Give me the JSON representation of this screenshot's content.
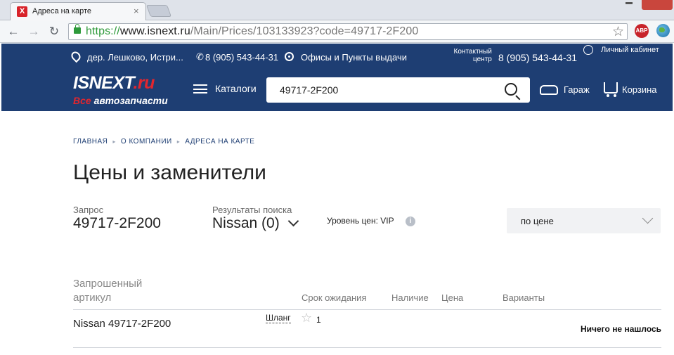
{
  "browser": {
    "tab_title": "Адреса на карте",
    "tab_close": "×",
    "url_proto": "https://",
    "url_host": "www.isnext.ru",
    "url_path": "/Main/Prices/103133923?code=49717-2F200",
    "ext_abp": "ABP"
  },
  "header": {
    "location": "дер. Лешково, Истри...",
    "phone": "8 (905) 543-44-31",
    "offices": "Офисы и Пункты выдачи",
    "contact_center_label_1": "Контактный",
    "contact_center_label_2": "центр",
    "contact_center_phone": "8 (905) 543-44-31",
    "account": "Личный кабинет",
    "logo_main": "ISNEXT",
    "logo_ru": ".ru",
    "logo_tag_1": "Все",
    "logo_tag_2": "автозапчасти",
    "catalogs": "Каталоги",
    "search_value": "49717-2F200",
    "garage": "Гараж",
    "cart": "Корзина"
  },
  "breadcrumb": [
    "ГЛАВНАЯ",
    "О КОМПАНИИ",
    "АДРЕСА НА КАРТЕ"
  ],
  "breadcrumb_sep": "▸",
  "page_title": "Цены и заменители",
  "query": {
    "label": "Запрос",
    "value": "49717-2F200"
  },
  "results": {
    "label": "Результаты поиска",
    "value": "Nissan (0)"
  },
  "price_level": "Уровень цен: VIP",
  "info_mark": "i",
  "sort": {
    "selected": "по цене"
  },
  "table": {
    "headers": {
      "requested": "Запрошенный артикул",
      "wait": "Срок ожидания",
      "availability": "Наличие",
      "price": "Цена",
      "variants": "Варианты"
    },
    "rows": [
      {
        "part": "Nissan 49717-2F200",
        "name": "Шланг",
        "count": "1",
        "result": "Ничего не нашлось"
      }
    ]
  }
}
